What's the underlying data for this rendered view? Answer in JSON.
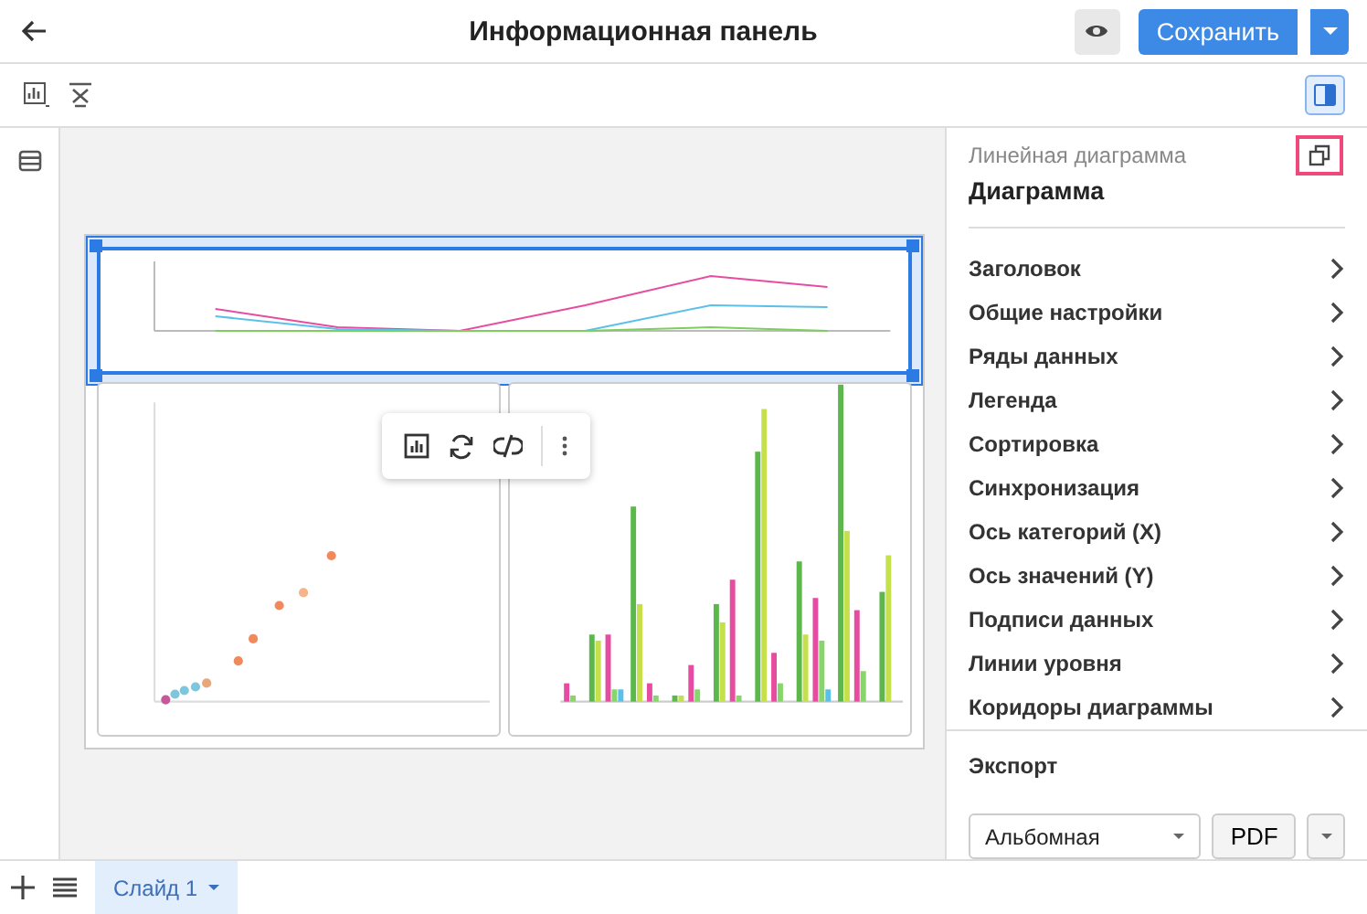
{
  "header": {
    "title": "Информационная панель",
    "save_label": "Сохранить"
  },
  "widgets": [
    {
      "kind": "line",
      "selected": true
    },
    {
      "kind": "scatter",
      "selected": false
    },
    {
      "kind": "bar",
      "selected": false
    }
  ],
  "panel": {
    "type_label": "Линейная диаграмма",
    "title": "Диаграмма",
    "sections": [
      "Заголовок",
      "Общие настройки",
      "Ряды данных",
      "Легенда",
      "Сортировка",
      "Синхронизация",
      "Ось категорий (X)",
      "Ось значений (Y)",
      "Подписи данных",
      "Линии уровня",
      "Коридоры диаграммы"
    ],
    "export": {
      "title": "Экспорт",
      "orientation": "Альбомная",
      "format": "PDF"
    }
  },
  "slides": [
    {
      "label": "Слайд 1",
      "selected": true
    }
  ]
}
